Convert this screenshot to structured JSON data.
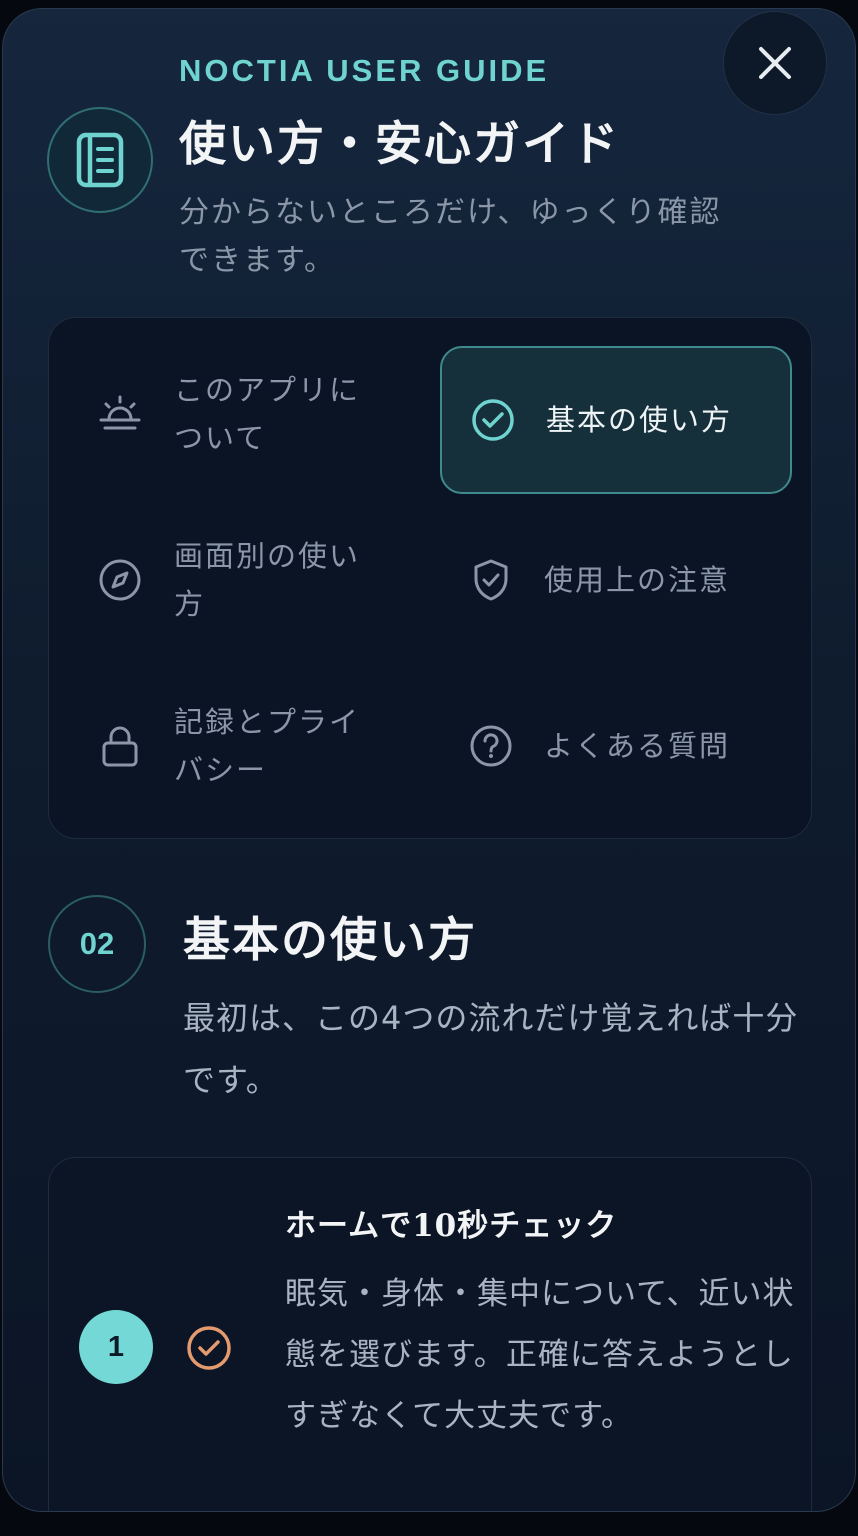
{
  "header": {
    "eyebrow": "NOCTIA USER GUIDE",
    "title": "使い方・安心ガイド",
    "subtitle": "分からないところだけ、ゆっくり確認できます。"
  },
  "menu": {
    "items": [
      {
        "label": "このアプリについて",
        "icon": "sunrise-icon",
        "active": false
      },
      {
        "label": "基本の使い方",
        "icon": "check-circle-icon",
        "active": true
      },
      {
        "label": "画面別の使い方",
        "icon": "compass-icon",
        "active": false
      },
      {
        "label": "使用上の注意",
        "icon": "shield-check-icon",
        "active": false
      },
      {
        "label": "記録とプライバシー",
        "icon": "lock-icon",
        "active": false
      },
      {
        "label": "よくある質問",
        "icon": "question-circle-icon",
        "active": false
      }
    ]
  },
  "section": {
    "number": "02",
    "title": "基本の使い方",
    "description": "最初は、この4つの流れだけ覚えれば十分です。"
  },
  "steps": [
    {
      "number": "1",
      "title": "ホームで10秒チェック",
      "body": "眠気・身体・集中について、近い状態を選びます。正確に答えようとしすぎなくて大丈夫です。"
    }
  ],
  "colors": {
    "accent": "#6fd3d0",
    "step_check": "#e39a6e",
    "background": "#0f1c2e"
  }
}
